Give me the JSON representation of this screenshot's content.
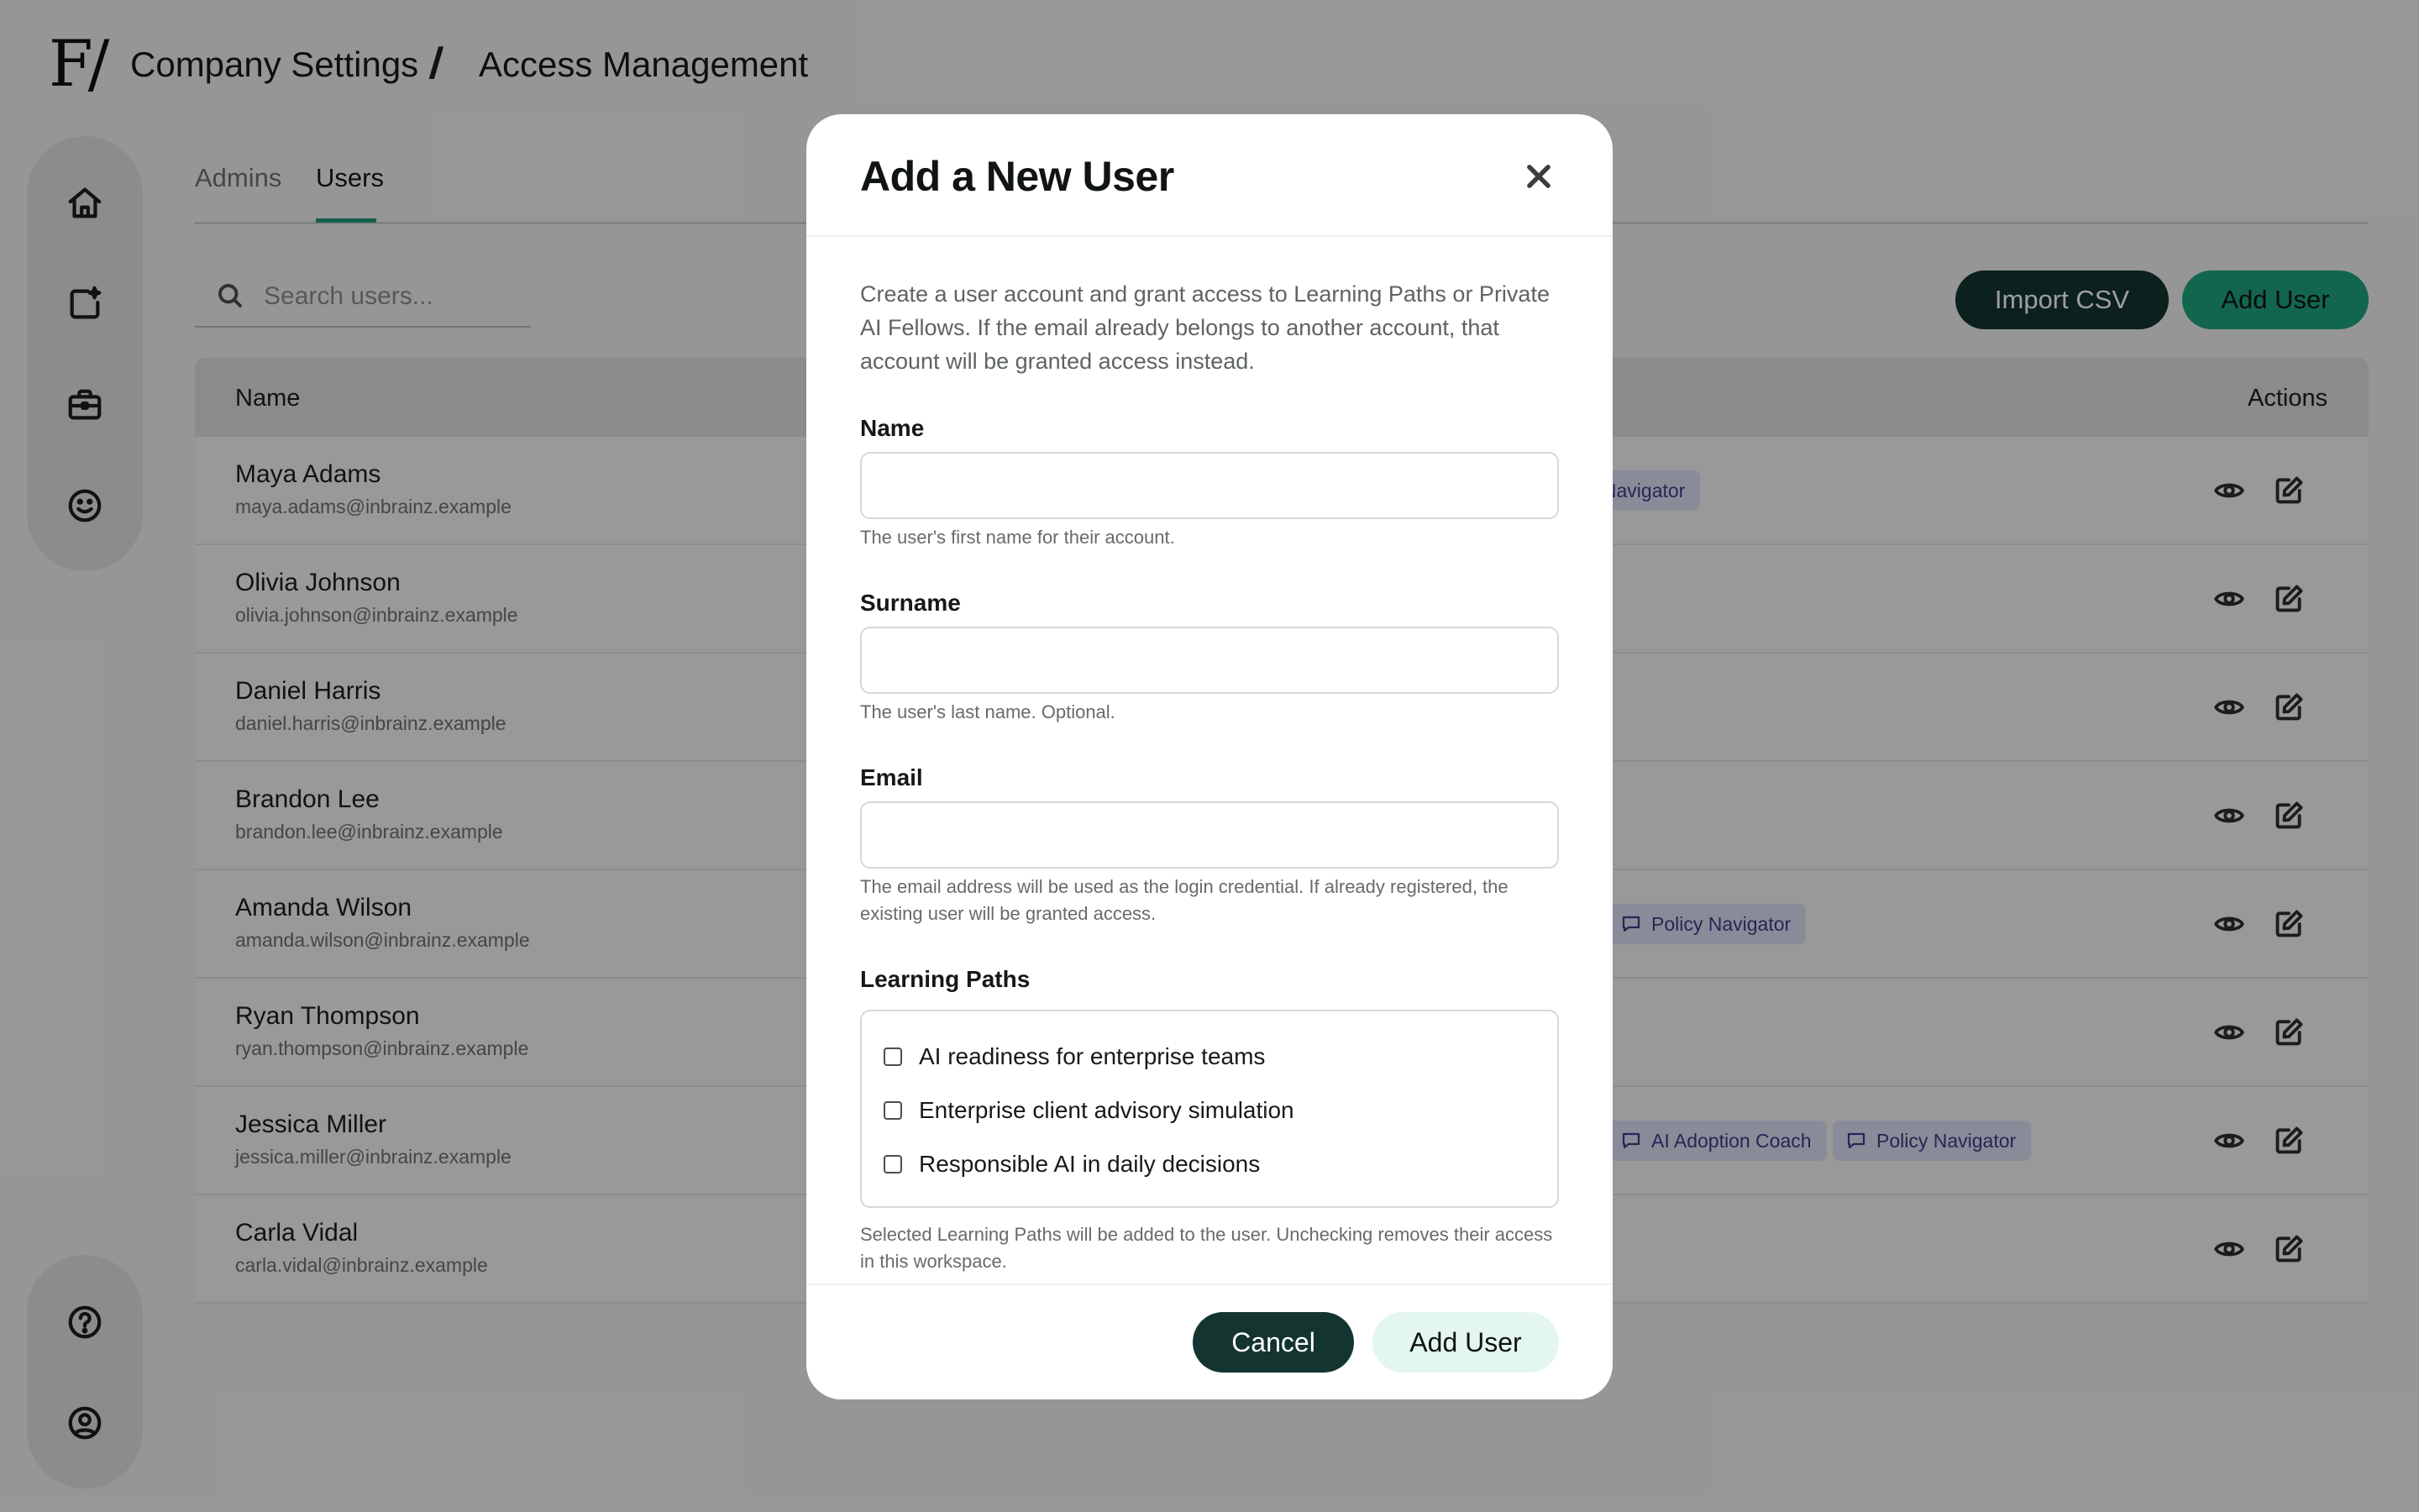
{
  "header": {
    "logo_text": "F/",
    "breadcrumb_parent": "Company Settings",
    "breadcrumb_separator": "/",
    "breadcrumb_current": "Access Management"
  },
  "sidebar": {
    "top_icons": [
      "home-icon",
      "new-document-icon",
      "briefcase-icon",
      "smile-icon"
    ],
    "bottom_icons": [
      "help-icon",
      "user-profile-icon"
    ]
  },
  "tabs": [
    {
      "label": "Admins",
      "active": false
    },
    {
      "label": "Users",
      "active": true
    }
  ],
  "search": {
    "placeholder": "Search users...",
    "value": ""
  },
  "toolbar": {
    "import_label": "Import CSV",
    "add_label": "Add User"
  },
  "table": {
    "headers": {
      "name": "Name",
      "actions": "Actions"
    },
    "rows": [
      {
        "name": "Maya Adams",
        "email": "maya.adams@inbrainz.example",
        "chips": [
          {
            "label": "y Navigator",
            "kind": "fellow"
          }
        ]
      },
      {
        "name": "Olivia Johnson",
        "email": "olivia.johnson@inbrainz.example",
        "chips": [
          {
            "label": "",
            "kind": "green"
          }
        ]
      },
      {
        "name": "Daniel Harris",
        "email": "daniel.harris@inbrainz.example",
        "chips": []
      },
      {
        "name": "Brandon Lee",
        "email": "brandon.lee@inbrainz.example",
        "chips": []
      },
      {
        "name": "Amanda Wilson",
        "email": "amanda.wilson@inbrainz.example",
        "chips": [
          {
            "label": "",
            "kind": "green"
          },
          {
            "label": "Policy Navigator",
            "kind": "fellow"
          }
        ]
      },
      {
        "name": "Ryan Thompson",
        "email": "ryan.thompson@inbrainz.example",
        "chips": [
          {
            "label": "",
            "kind": "green"
          }
        ]
      },
      {
        "name": "Jessica Miller",
        "email": "jessica.miller@inbrainz.example",
        "chips": [
          {
            "label": "",
            "kind": "green"
          },
          {
            "label": "AI Adoption Coach",
            "kind": "fellow"
          },
          {
            "label": "Policy Navigator",
            "kind": "fellow"
          }
        ]
      },
      {
        "name": "Carla Vidal",
        "email": "carla.vidal@inbrainz.example",
        "chips": []
      }
    ]
  },
  "modal": {
    "title": "Add a New User",
    "description": "Create a user account and grant access to Learning Paths or Private AI Fellows. If the email already belongs to another account, that account will be granted access instead.",
    "fields": {
      "name": {
        "label": "Name",
        "value": "",
        "help": "The user's first name for their account."
      },
      "surname": {
        "label": "Surname",
        "value": "",
        "help": "The user's last name. Optional."
      },
      "email": {
        "label": "Email",
        "value": "",
        "help": "The email address will be used as the login credential. If already registered, the existing user will be granted access."
      }
    },
    "learning_paths": {
      "label": "Learning Paths",
      "options": [
        {
          "label": "AI readiness for enterprise teams",
          "checked": false
        },
        {
          "label": "Enterprise client advisory simulation",
          "checked": false
        },
        {
          "label": "Responsible AI in daily decisions",
          "checked": false
        }
      ],
      "help": "Selected Learning Paths will be added to the user. Unchecking removes their access in this workspace."
    },
    "cancel_label": "Cancel",
    "submit_label": "Add User"
  },
  "colors": {
    "accent": "#1fa57e",
    "dark_button": "#143430",
    "chip_purple": "#dfe0f6",
    "chip_green": "#7fe38a",
    "overlay": "rgba(0,0,0,0.38)"
  }
}
